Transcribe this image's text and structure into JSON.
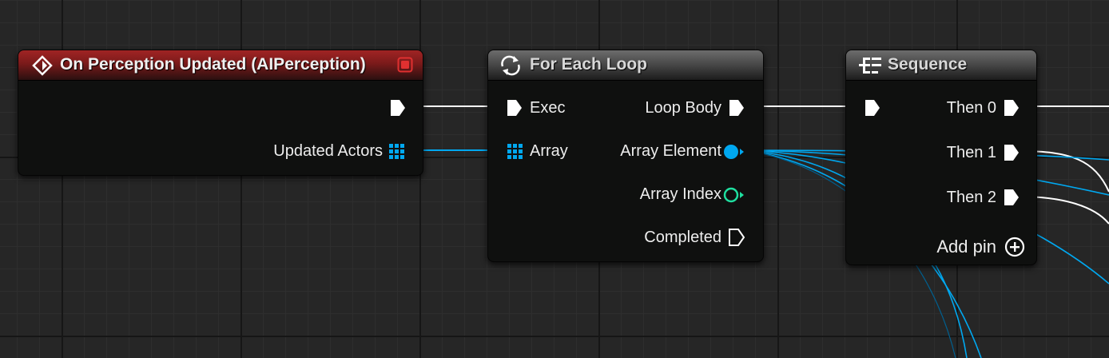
{
  "nodes": {
    "perception": {
      "title": "On Perception Updated (AIPerception)",
      "outputs": [
        "Updated Actors"
      ]
    },
    "foreach": {
      "title": "For Each Loop",
      "inputs": [
        "Exec",
        "Array"
      ],
      "outputs": [
        "Loop Body",
        "Array Element",
        "Array Index",
        "Completed"
      ]
    },
    "sequence": {
      "title": "Sequence",
      "outputs": [
        "Then 0",
        "Then 1",
        "Then 2"
      ],
      "add_pin": "Add pin"
    }
  },
  "colors": {
    "exec_wire": "#ffffff",
    "object_wire": "#00a8f0",
    "integer_pin": "#1fe0a0",
    "event_header": "#8c1e1e",
    "macro_header": "#5a5a5a",
    "delegate_box": "#e03030"
  },
  "icons": [
    "event-diamond-icon",
    "delegate-icon",
    "loop-icon",
    "sequence-icon",
    "exec-pin-icon",
    "array-pin-icon",
    "object-pin-icon",
    "integer-pin-icon",
    "add-pin-icon"
  ]
}
